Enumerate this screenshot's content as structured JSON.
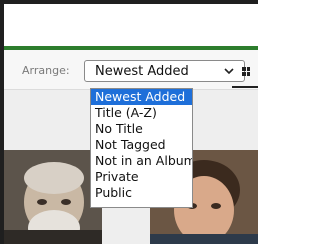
{
  "toolbar": {
    "arrange_label": "Arrange:",
    "arrange_value": "Newest Added",
    "view_icon": "grid-view-icon"
  },
  "dropdown": {
    "options": [
      "Newest Added",
      "Title (A-Z)",
      "No Title",
      "Not Tagged",
      "Not in an Album",
      "Private",
      "Public"
    ],
    "selected": "Newest Added"
  },
  "colors": {
    "accent_line": "#2d7d2d",
    "selection": "#1e6fd9"
  }
}
